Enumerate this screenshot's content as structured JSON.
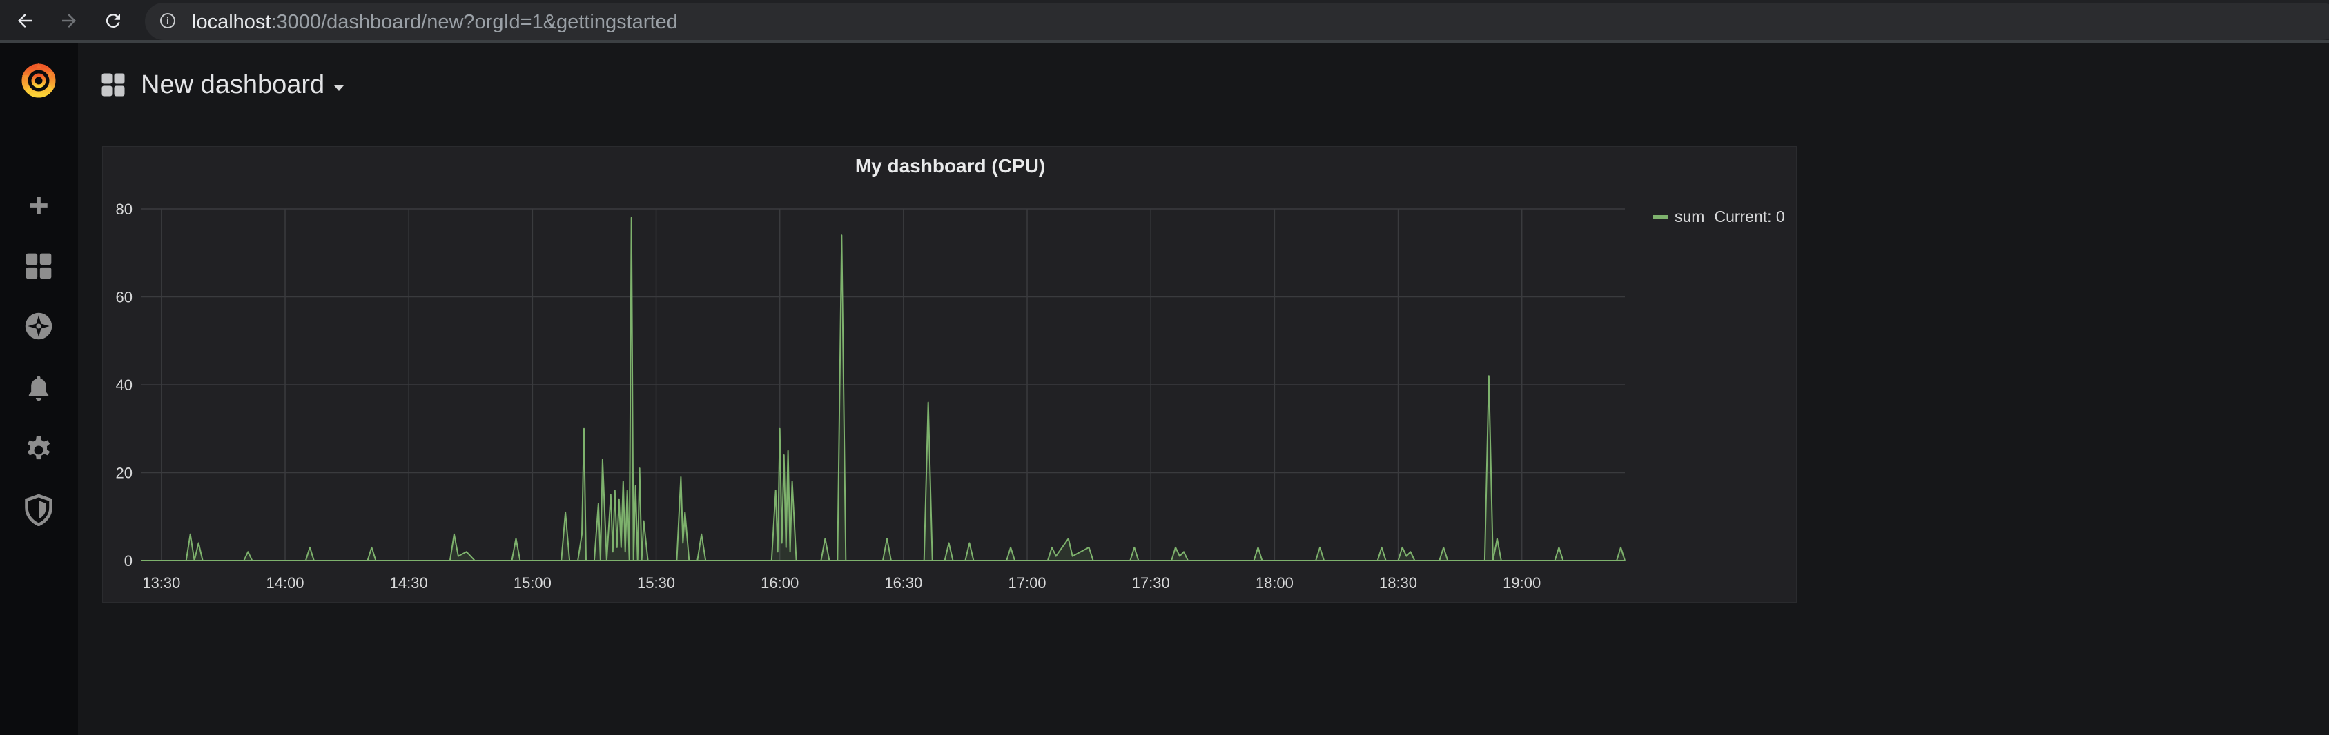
{
  "browser": {
    "url_host": "localhost",
    "url_rest": ":3000/dashboard/new?orgId=1&gettingstarted"
  },
  "sidebar": {
    "items": [
      {
        "icon": "grafana-logo-icon"
      },
      {
        "icon": "plus-icon"
      },
      {
        "icon": "dashboards-icon"
      },
      {
        "icon": "explore-compass-icon"
      },
      {
        "icon": "bell-icon"
      },
      {
        "icon": "gear-icon"
      },
      {
        "icon": "shield-icon"
      }
    ]
  },
  "header": {
    "title": "New dashboard"
  },
  "colors": {
    "series": "#7eb26d",
    "logo_orange": "#f05a28",
    "background": "#161719",
    "panel": "#212124"
  },
  "chart_data": {
    "type": "line",
    "title": "My dashboard (CPU)",
    "xlabel": "",
    "ylabel": "",
    "ylim": [
      0,
      80
    ],
    "yticks": [
      "0",
      "20",
      "40",
      "60",
      "80"
    ],
    "xlim": [
      "13:25",
      "19:25"
    ],
    "xticks": [
      "13:30",
      "14:00",
      "14:30",
      "15:00",
      "15:30",
      "16:00",
      "16:30",
      "17:00",
      "17:30",
      "18:00",
      "18:30",
      "19:00"
    ],
    "grid": true,
    "legend_placement": "right",
    "series": [
      {
        "name": "sum",
        "current": "Current: 0",
        "points": [
          [
            "13:25",
            0
          ],
          [
            "13:36",
            0
          ],
          [
            "13:37",
            6
          ],
          [
            "13:38",
            0
          ],
          [
            "13:39",
            4
          ],
          [
            "13:40",
            0
          ],
          [
            "13:50",
            0
          ],
          [
            "13:51",
            2
          ],
          [
            "13:52",
            0
          ],
          [
            "14:05",
            0
          ],
          [
            "14:06",
            3
          ],
          [
            "14:07",
            0
          ],
          [
            "14:20",
            0
          ],
          [
            "14:21",
            3
          ],
          [
            "14:22",
            0
          ],
          [
            "14:40",
            0
          ],
          [
            "14:41",
            6
          ],
          [
            "14:42",
            1
          ],
          [
            "14:44",
            2
          ],
          [
            "14:46",
            0
          ],
          [
            "14:55",
            0
          ],
          [
            "14:56",
            5
          ],
          [
            "14:57",
            0
          ],
          [
            "15:00",
            0
          ],
          [
            "15:07",
            0
          ],
          [
            "15:08",
            11
          ],
          [
            "15:09",
            0
          ],
          [
            "15:11",
            0
          ],
          [
            "15:12",
            6
          ],
          [
            "15:13",
            0
          ],
          [
            "15:12.5",
            30
          ],
          [
            "15:13.5",
            0
          ],
          [
            "15:15",
            0
          ],
          [
            "15:16",
            13
          ],
          [
            "15:16.5",
            0
          ],
          [
            "15:17",
            23
          ],
          [
            "15:18",
            0
          ],
          [
            "15:19",
            15
          ],
          [
            "15:19.5",
            2
          ],
          [
            "15:20",
            16
          ],
          [
            "15:20.5",
            3
          ],
          [
            "15:21",
            14
          ],
          [
            "15:21.5",
            3
          ],
          [
            "15:22",
            18
          ],
          [
            "15:22.5",
            2
          ],
          [
            "15:23",
            16
          ],
          [
            "15:23.5",
            0
          ],
          [
            "15:24",
            78
          ],
          [
            "15:24.5",
            0
          ],
          [
            "15:25",
            17
          ],
          [
            "15:25.5",
            0
          ],
          [
            "15:26",
            21
          ],
          [
            "15:26.5",
            0
          ],
          [
            "15:27",
            9
          ],
          [
            "15:28",
            0
          ],
          [
            "15:35",
            0
          ],
          [
            "15:36",
            19
          ],
          [
            "15:36.5",
            4
          ],
          [
            "15:37",
            11
          ],
          [
            "15:38",
            0
          ],
          [
            "15:40",
            0
          ],
          [
            "15:41",
            6
          ],
          [
            "15:42",
            0
          ],
          [
            "15:58",
            0
          ],
          [
            "15:59",
            16
          ],
          [
            "15:59.5",
            2
          ],
          [
            "16:00",
            30
          ],
          [
            "16:00.5",
            4
          ],
          [
            "16:01",
            24
          ],
          [
            "16:01.5",
            3
          ],
          [
            "16:02",
            25
          ],
          [
            "16:02.5",
            2
          ],
          [
            "16:03",
            18
          ],
          [
            "16:04",
            0
          ],
          [
            "16:10",
            0
          ],
          [
            "16:11",
            5
          ],
          [
            "16:12",
            0
          ],
          [
            "16:14",
            0
          ],
          [
            "16:15",
            74
          ],
          [
            "16:16",
            0
          ],
          [
            "16:25",
            0
          ],
          [
            "16:26",
            5
          ],
          [
            "16:27",
            0
          ],
          [
            "16:35",
            0
          ],
          [
            "16:36",
            36
          ],
          [
            "16:37",
            0
          ],
          [
            "16:40",
            0
          ],
          [
            "16:41",
            4
          ],
          [
            "16:42",
            0
          ],
          [
            "16:45",
            0
          ],
          [
            "16:46",
            4
          ],
          [
            "16:47",
            0
          ],
          [
            "16:55",
            0
          ],
          [
            "16:56",
            3
          ],
          [
            "16:57",
            0
          ],
          [
            "17:05",
            0
          ],
          [
            "17:06",
            3
          ],
          [
            "17:07",
            1
          ],
          [
            "17:10",
            5
          ],
          [
            "17:11",
            1
          ],
          [
            "17:15",
            3
          ],
          [
            "17:16",
            0
          ],
          [
            "17:25",
            0
          ],
          [
            "17:26",
            3
          ],
          [
            "17:27",
            0
          ],
          [
            "17:35",
            0
          ],
          [
            "17:36",
            3
          ],
          [
            "17:37",
            1
          ],
          [
            "17:38",
            2
          ],
          [
            "17:39",
            0
          ],
          [
            "17:55",
            0
          ],
          [
            "17:56",
            3
          ],
          [
            "17:57",
            0
          ],
          [
            "18:10",
            0
          ],
          [
            "18:11",
            3
          ],
          [
            "18:12",
            0
          ],
          [
            "18:25",
            0
          ],
          [
            "18:26",
            3
          ],
          [
            "18:27",
            0
          ],
          [
            "18:30",
            0
          ],
          [
            "18:31",
            3
          ],
          [
            "18:32",
            1
          ],
          [
            "18:33",
            2
          ],
          [
            "18:34",
            0
          ],
          [
            "18:40",
            0
          ],
          [
            "18:41",
            3
          ],
          [
            "18:42",
            0
          ],
          [
            "18:51",
            0
          ],
          [
            "18:52",
            42
          ],
          [
            "18:53",
            0
          ],
          [
            "18:54",
            5
          ],
          [
            "18:55",
            0
          ],
          [
            "19:08",
            0
          ],
          [
            "19:09",
            3
          ],
          [
            "19:10",
            0
          ],
          [
            "19:23",
            0
          ],
          [
            "19:24",
            3
          ],
          [
            "19:25",
            0
          ]
        ]
      }
    ]
  }
}
